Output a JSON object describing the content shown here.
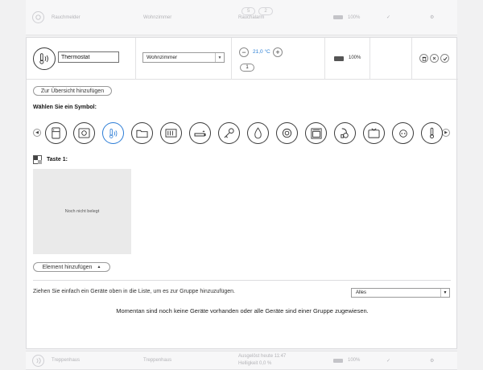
{
  "top_row": {
    "name": "Rauchmelder",
    "room": "Wohnzimmer",
    "status": "Rauchalarm",
    "buttons": [
      "5",
      "2"
    ],
    "battery": "100%",
    "check": "✓",
    "gear": "⚙"
  },
  "edit_row": {
    "name_value": "Thermostat",
    "room_value": "Wohnzimmer",
    "temperature": "21,0 °C",
    "minus": "−",
    "plus": "+",
    "mode_value": "1",
    "battery": "100%"
  },
  "add_overview_label": "Zur Übersicht hinzufügen",
  "choose_symbol_label": "Wählen Sie ein Symbol:",
  "symbols": [
    "fridge-icon",
    "safe-icon",
    "thermostat-icon",
    "folder-icon",
    "radiator-icon",
    "smoke-icon",
    "key-icon",
    "drop-icon",
    "sensor-icon",
    "oven-icon",
    "vacuum-icon",
    "tv-icon",
    "plug-icon",
    "thermometer-icon"
  ],
  "selected_symbol": "thermostat-icon",
  "key_label": "Taste 1:",
  "key_placeholder": "Noch nicht belegt",
  "add_element_label": "Element hinzufügen",
  "drag_text": "Ziehen Sie einfach ein Geräte oben in die Liste, um es zur Gruppe hinzuzufügen.",
  "filter_value": "Alles",
  "empty_text": "Momentan sind noch keine Geräte vorhanden oder alle Geräte sind einer Gruppe zugewiesen.",
  "bottom_row": {
    "name": "Treppenhaus",
    "room": "Treppenhaus",
    "status_line1": "Ausgelöst heute 11:47",
    "status_line2": "Helligkeit 0,0 %",
    "battery": "100%",
    "check": "✓",
    "gear": "⚙"
  },
  "colors": {
    "accent": "#2b7cd6",
    "background": "#f1f1f2",
    "panel": "#ffffff"
  }
}
